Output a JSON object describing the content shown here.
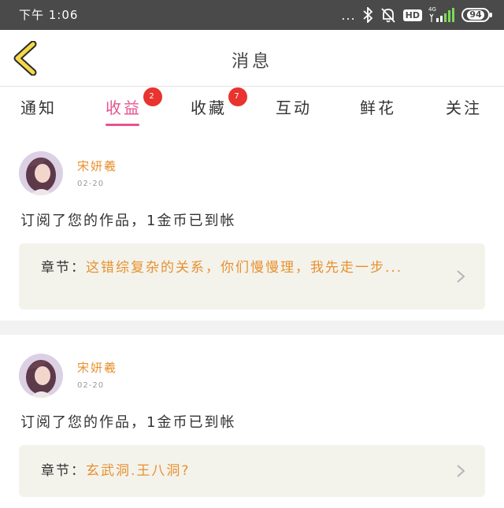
{
  "status_bar": {
    "time": "下午 1:06",
    "dots": "...",
    "hd": "HD",
    "network": "4G",
    "battery": "94"
  },
  "header": {
    "title": "消息"
  },
  "tabs": [
    {
      "label": "通知",
      "badge": ""
    },
    {
      "label": "收益",
      "badge": "2",
      "active": true
    },
    {
      "label": "收藏",
      "badge": "7"
    },
    {
      "label": "互动",
      "badge": ""
    },
    {
      "label": "鲜花",
      "badge": ""
    },
    {
      "label": "关注",
      "badge": ""
    }
  ],
  "messages": [
    {
      "sender": "宋妍羲",
      "date": "02-20",
      "text": "订阅了您的作品，1金币已到帐",
      "chapter_label": "章节：",
      "chapter_title": "这错综复杂的关系，你们慢慢理，我先走一步..."
    },
    {
      "sender": "宋妍羲",
      "date": "02-20",
      "text": "订阅了您的作品，1金币已到帐",
      "chapter_label": "章节：",
      "chapter_title": "玄武洞.王八洞?"
    }
  ],
  "colors": {
    "accent": "#e6538f",
    "badge": "#e8332f",
    "name": "#e8902f",
    "back_arrow": "#f5d94a"
  }
}
